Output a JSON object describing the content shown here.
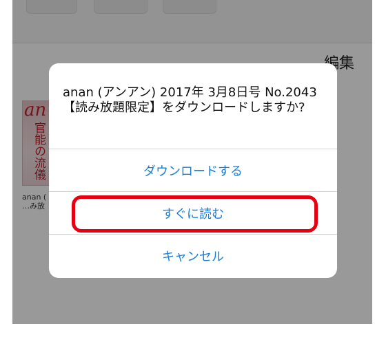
{
  "background": {
    "edit_label": "編集",
    "book": {
      "cover_logo": "an",
      "cover_title": "官能の流儀",
      "caption_line1": "anan (",
      "caption_line2": "…み放"
    }
  },
  "alert": {
    "message": "anan (アンアン) 2017年 3月8日号 No.2043 【読み放題限定】をダウンロードしますか?",
    "buttons": {
      "download": "ダウンロードする",
      "read_now": "すぐに読む",
      "cancel": "キャンセル"
    }
  },
  "colors": {
    "button_text": "#1a7fd9",
    "highlight_ring": "#e50012"
  }
}
